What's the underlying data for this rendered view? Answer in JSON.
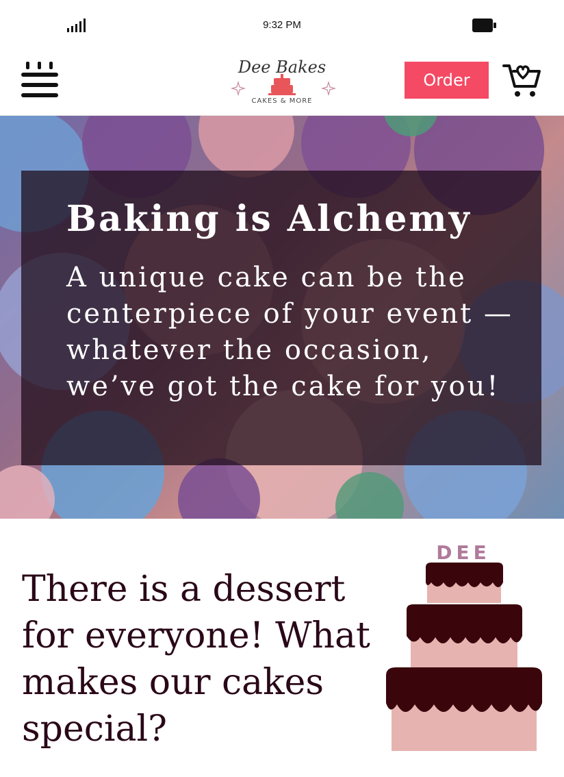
{
  "status_bar": {
    "time": "9:32 PM"
  },
  "header": {
    "logo_title": "Dee Bakes",
    "logo_subtitle": "CAKES & MORE",
    "order_label": "Order"
  },
  "hero": {
    "title": "Baking is Alchemy",
    "text": "A unique cake can be the centerpiece of your event — whatever the occasion, we’ve got the cake for you!"
  },
  "section": {
    "heading": "There is a dessert for everyone! What makes our cakes special?",
    "cake_label": "DEE"
  },
  "colors": {
    "accent": "#f44a64",
    "heading_text": "#2a0818",
    "cake_chocolate": "#3a060c",
    "cake_pink": "#e6b3b0",
    "cake_label": "#b07a9a"
  }
}
